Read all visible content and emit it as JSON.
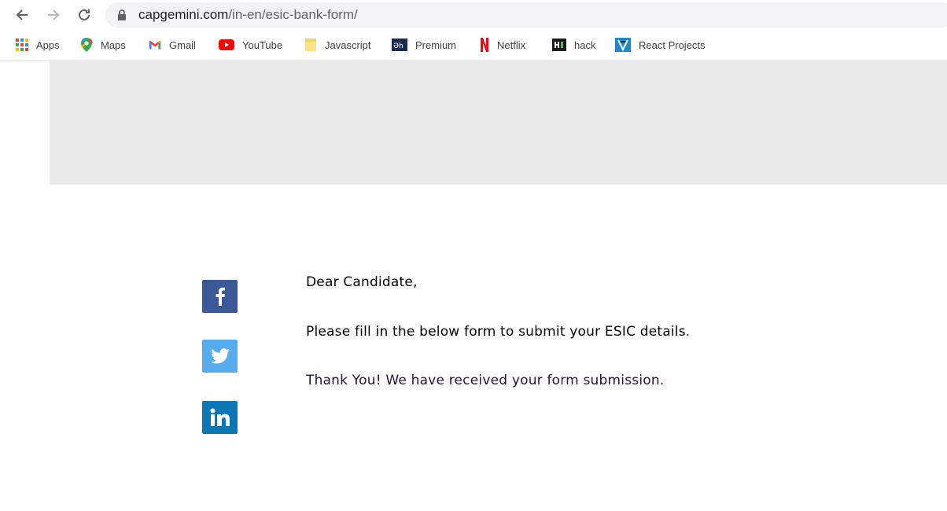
{
  "browser": {
    "url_host": "capgemini.com",
    "url_path": "/in-en/esic-bank-form/",
    "back_icon": "arrow-left-icon",
    "forward_icon": "arrow-right-icon",
    "reload_icon": "reload-icon",
    "lock_icon": "lock-icon"
  },
  "bookmarks": [
    {
      "label": "Apps",
      "icon": "apps-grid-icon"
    },
    {
      "label": "Maps",
      "icon": "maps-pin-icon"
    },
    {
      "label": "Gmail",
      "icon": "gmail-icon"
    },
    {
      "label": "YouTube",
      "icon": "youtube-icon"
    },
    {
      "label": "Javascript",
      "icon": "folder-icon"
    },
    {
      "label": "Premium",
      "icon": "premium-icon"
    },
    {
      "label": "Netflix",
      "icon": "netflix-icon"
    },
    {
      "label": "hack",
      "icon": "hackerrank-icon"
    },
    {
      "label": "React Projects",
      "icon": "react-projects-icon"
    }
  ],
  "social": {
    "facebook_icon": "facebook-icon",
    "twitter_icon": "twitter-icon",
    "linkedin_icon": "linkedin-icon"
  },
  "content": {
    "greeting": "Dear Candidate,",
    "instruction": "Please fill in the below form to submit your ESIC details.",
    "confirmation": "Thank You! We have received your form submission."
  },
  "colors": {
    "facebook": "#3b5998",
    "twitter": "#55acee",
    "linkedin": "#0b77b5",
    "hero_bg": "#ebebeb",
    "confirmation_text": "#24113e"
  }
}
